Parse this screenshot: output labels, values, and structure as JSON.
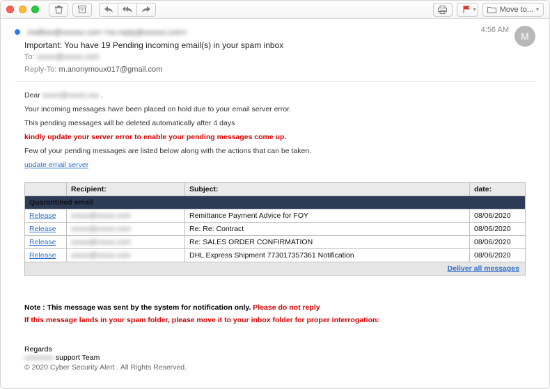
{
  "toolbar": {
    "moveto_label": "Move to...",
    "time": "4:56 AM",
    "avatar_initial": "M"
  },
  "header": {
    "sender": "mailbox@xxxxxx.com <no-reply@xxxxxx.com>",
    "subject": "Important: You have 19 Pending incoming email(s) in your spam  inbox",
    "to_label": "To:",
    "to_value": "xxxxx@xxxxx.com",
    "replyto_label": "Reply-To:",
    "replyto_value": "m.anonymoux017@gmail.com"
  },
  "body": {
    "greeting_prefix": "Dear ",
    "greeting_name": "xxxxx@xxxxx.xxx",
    "greeting_suffix": " .",
    "line1": "Your incoming messages have been placed on hold due to your email server error.",
    "line2": "This pending messages will be deleted automatically after 4 days",
    "line3": "kindly update your server error to enable your pending messages come up.",
    "line4": "Few of your pending messages are listed below along with the actions that can be taken.",
    "link": "update email server"
  },
  "table": {
    "col0": "",
    "col1": "Recipient:",
    "col2": "Subject:",
    "col3": "date:",
    "section": "Quarantined email",
    "rows": [
      {
        "action": "Release",
        "recipient": "xxxxx@xxxxx.com",
        "subject": " Remittance Payment Advice for FOY",
        "date": "08/06/2020"
      },
      {
        "action": "Release",
        "recipient": "xxxxx@xxxxx.com",
        "subject": "Re: Re: Contract",
        "date": "08/06/2020"
      },
      {
        "action": "Release",
        "recipient": "xxxxx@xxxxx.com",
        "subject": "Re: SALES ORDER CONFIRMATION",
        "date": "08/06/2020"
      },
      {
        "action": "Release",
        "recipient": "xxxxx@xxxxx.com",
        "subject": "DHL Express Shipment 773017357361 Notification",
        "date": "08/06/2020"
      }
    ],
    "deliver": "Deliver all messages"
  },
  "footer": {
    "note_prefix": "Note : This message was sent by the system for notification only.   ",
    "note_red": "Please do not reply",
    "spam": "If this message lands in your spam folder, please move it to your inbox folder for proper interrogation:",
    "regards": "Regards",
    "team_prefix": "xxxxxxxx",
    "team_suffix": " support Team",
    "copyright": "© 2020 Cyber Security Alert . All Rights Reserved."
  }
}
